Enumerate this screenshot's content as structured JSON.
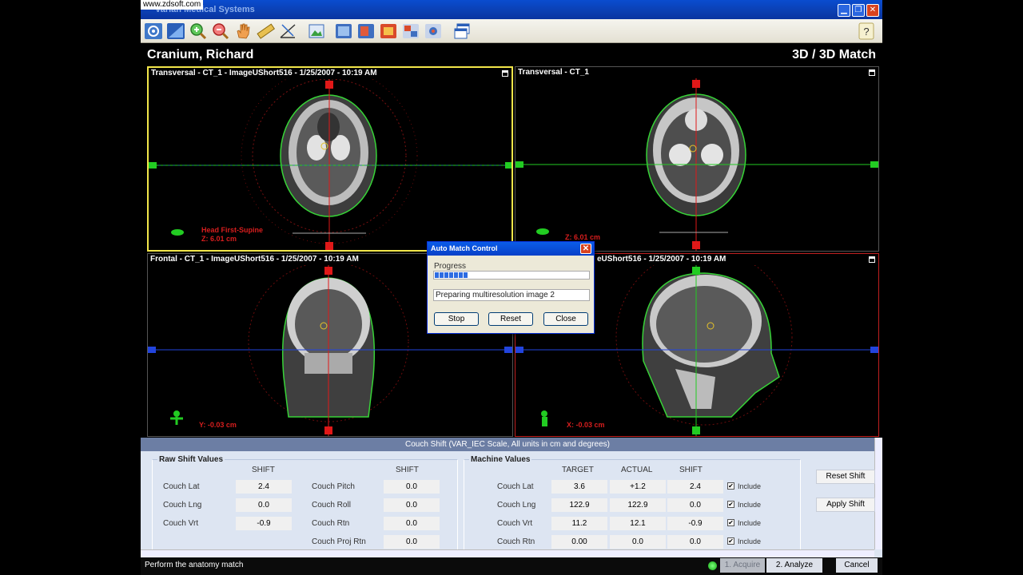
{
  "watermark": "www.zdsoft.com",
  "window": {
    "title": "Varian Medical Systems",
    "buttons": {
      "minimize": "▁",
      "restore": "❐",
      "close": "✕"
    }
  },
  "toolbar": {
    "help": "?"
  },
  "patient": {
    "name": "Cranium, Richard"
  },
  "module": {
    "title": "3D / 3D Match"
  },
  "views": {
    "tl": {
      "header": "Transversal - CT_1 - ImageUShort516 - 1/25/2007 - 10:19 AM",
      "orient_line1": "Head First-Supine",
      "orient_line2": "Z: 6.01 cm"
    },
    "tr": {
      "header": "Transversal - CT_1",
      "coord": "Z: 6.01 cm"
    },
    "bl": {
      "header": "Frontal - CT_1 - ImageUShort516 - 1/25/2007 - 10:19 AM",
      "coord": "Y: -0.03 cm"
    },
    "br": {
      "header": "eUShort516 - 1/25/2007 - 10:19 AM",
      "coord": "X: -0.03 cm"
    }
  },
  "dialog": {
    "title": "Auto Match Control",
    "progress_label": "Progress",
    "progress": 0.22,
    "status": "Preparing multiresolution image 2",
    "buttons": {
      "stop": "Stop",
      "reset": "Reset",
      "close": "Close"
    }
  },
  "shift_panel": {
    "header": "Couch Shift (VAR_IEC Scale, All units in cm and degrees)",
    "raw": {
      "title": "Raw Shift Values",
      "col": "SHIFT",
      "left_rows": [
        {
          "label": "Couch Lat",
          "value": "2.4"
        },
        {
          "label": "Couch Lng",
          "value": "0.0"
        },
        {
          "label": "Couch Vrt",
          "value": "-0.9"
        }
      ],
      "right_rows": [
        {
          "label": "Couch Pitch",
          "value": "0.0"
        },
        {
          "label": "Couch Roll",
          "value": "0.0"
        },
        {
          "label": "Couch Rtn",
          "value": "0.0"
        },
        {
          "label": "Couch Proj Rtn",
          "value": "0.0"
        }
      ]
    },
    "machine": {
      "title": "Machine Values",
      "cols": {
        "target": "TARGET",
        "actual": "ACTUAL",
        "shift": "SHIFT"
      },
      "include_label": "Include",
      "check_mark": "✔",
      "rows": [
        {
          "label": "Couch Lat",
          "target": "3.6",
          "actual": "+1.2",
          "shift": "2.4"
        },
        {
          "label": "Couch Lng",
          "target": "122.9",
          "actual": "122.9",
          "shift": "0.0"
        },
        {
          "label": "Couch Vrt",
          "target": "11.2",
          "actual": "12.1",
          "shift": "-0.9"
        },
        {
          "label": "Couch Rtn",
          "target": "0.00",
          "actual": "0.0",
          "shift": "0.0"
        }
      ]
    },
    "buttons": {
      "reset_shift": "Reset Shift",
      "apply_shift": "Apply Shift"
    }
  },
  "statusbar": {
    "message": "Perform the anatomy match",
    "steps": {
      "acquire": "1. Acquire",
      "analyze": "2. Analyze"
    },
    "cancel": "Cancel"
  },
  "colors": {
    "accent": "#0a4ccf",
    "panel": "#dde5f2",
    "crosshair_red": "#e01818",
    "crosshair_green": "#22cc22",
    "contour": "#37d337"
  }
}
